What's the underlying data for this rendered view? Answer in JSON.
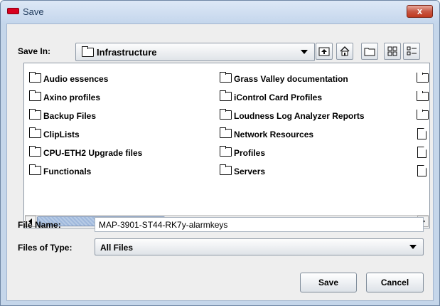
{
  "window": {
    "title": "Save",
    "close_label": "x"
  },
  "save_in": {
    "label": "Save In:",
    "value": "Infrastructure"
  },
  "toolbar": {
    "up_icon": "up-folder-icon",
    "home_icon": "home-icon",
    "new_folder_icon": "new-folder-icon",
    "list_view_icon": "list-view-icon",
    "details_view_icon": "details-view-icon"
  },
  "files": {
    "column1": [
      {
        "name": "Audio essences",
        "icon": "folder-icon"
      },
      {
        "name": "Axino profiles",
        "icon": "folder-icon"
      },
      {
        "name": "Backup Files",
        "icon": "folder-icon"
      },
      {
        "name": "ClipLists",
        "icon": "folder-icon"
      },
      {
        "name": "CPU-ETH2 Upgrade files",
        "icon": "folder-icon"
      },
      {
        "name": "Functionals",
        "icon": "folder-icon"
      }
    ],
    "column2": [
      {
        "name": "Grass Valley documentation",
        "icon": "folder-icon"
      },
      {
        "name": "iControl Card Profiles",
        "icon": "folder-icon"
      },
      {
        "name": "Loudness Log Analyzer Reports",
        "icon": "folder-icon"
      },
      {
        "name": "Network Resources",
        "icon": "folder-icon"
      },
      {
        "name": "Profiles",
        "icon": "folder-icon"
      },
      {
        "name": "Servers",
        "icon": "folder-icon"
      }
    ]
  },
  "file_name": {
    "label": "File Name:",
    "value": "MAP-3901-ST44-RK7y-alarmkeys"
  },
  "file_type": {
    "label": "Files of Type:",
    "value": "All Files"
  },
  "buttons": {
    "save": "Save",
    "cancel": "Cancel"
  },
  "colors": {
    "frame": "#c5d6ea",
    "close": "#c75844",
    "title_text": "#1e395b"
  }
}
